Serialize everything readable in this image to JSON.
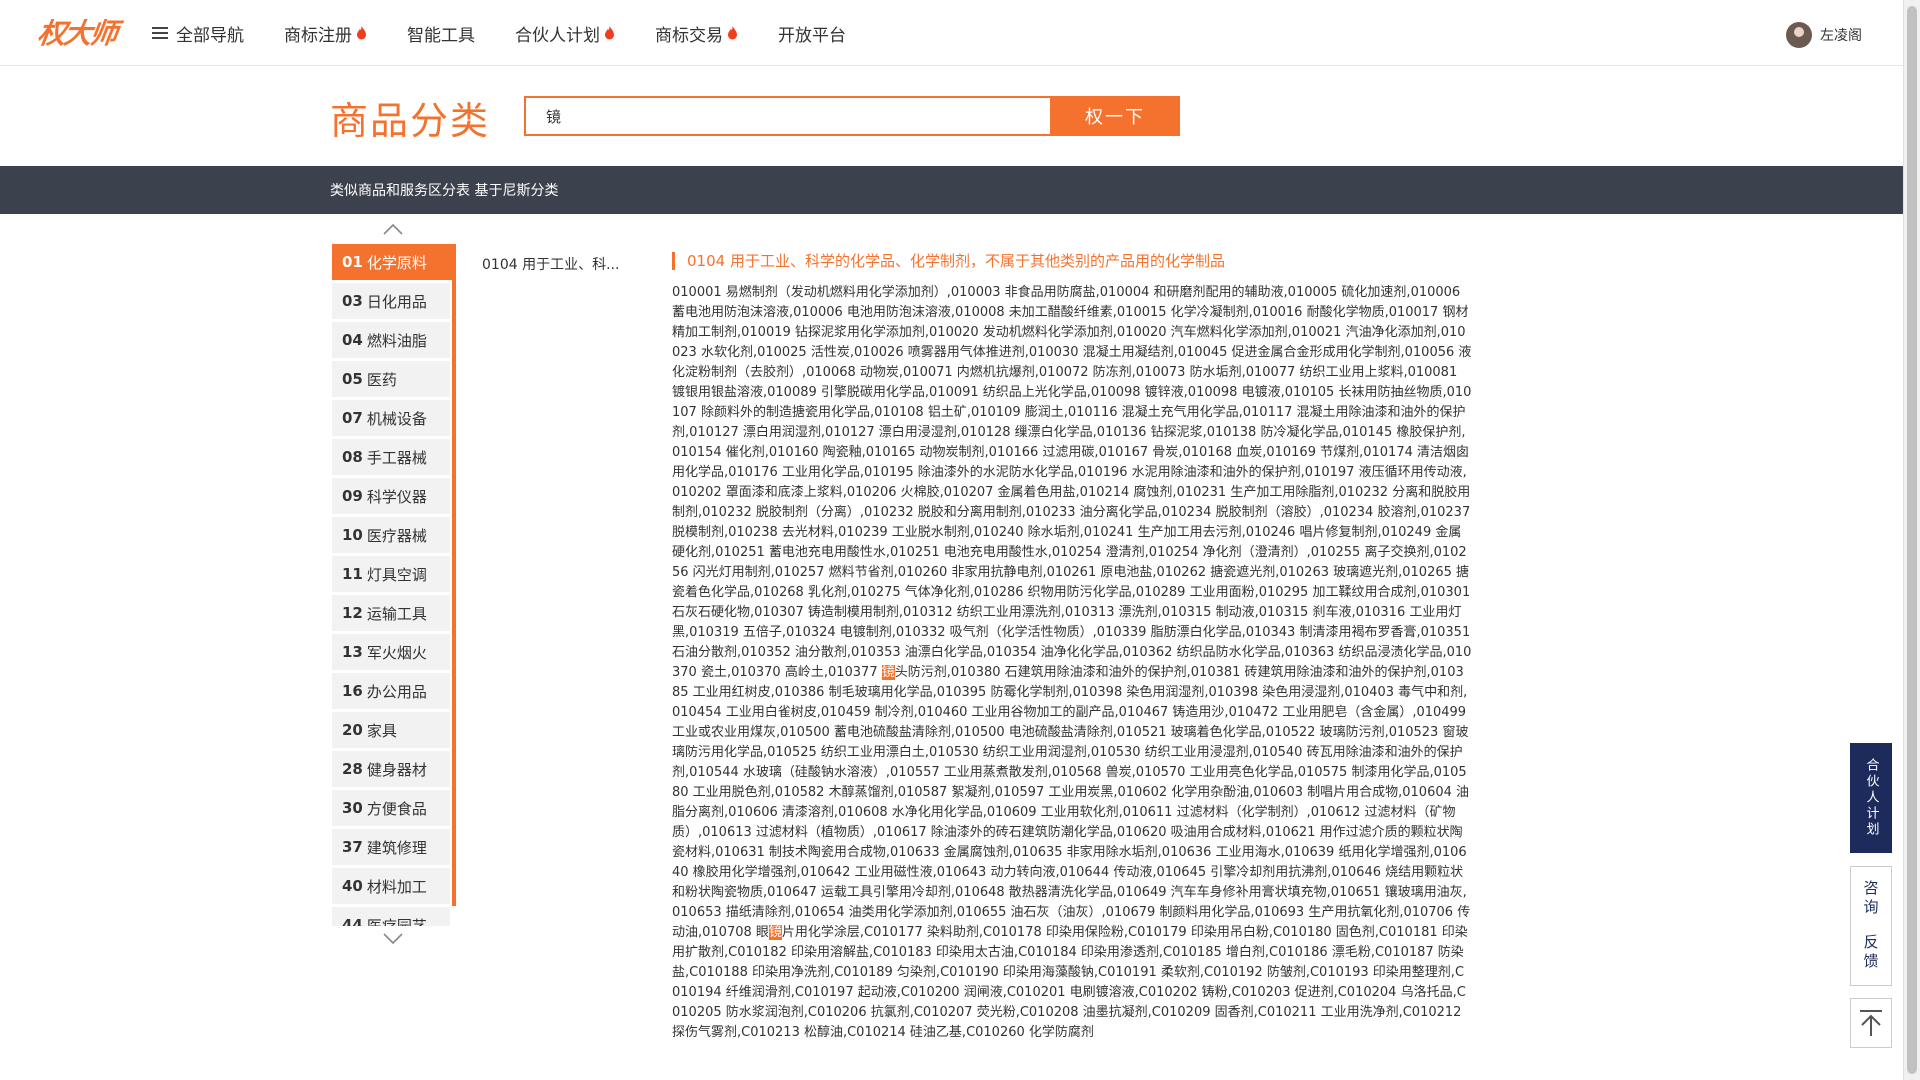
{
  "header": {
    "logo_text": "权大师",
    "nav": [
      {
        "label": "全部导航",
        "hot": false,
        "menu": true
      },
      {
        "label": "商标注册",
        "hot": true
      },
      {
        "label": "智能工具",
        "hot": false
      },
      {
        "label": "合伙人计划",
        "hot": true
      },
      {
        "label": "商标交易",
        "hot": true
      },
      {
        "label": "开放平台",
        "hot": false
      }
    ],
    "user_name": "左凌阁"
  },
  "search": {
    "title": "商品分类",
    "query": "镜",
    "button_label": "权一下"
  },
  "band": {
    "text": "类似商品和服务区分表 基于尼斯分类"
  },
  "categories": [
    {
      "num": "01",
      "label": "化学原料",
      "active": true
    },
    {
      "num": "03",
      "label": "日化用品"
    },
    {
      "num": "04",
      "label": "燃料油脂"
    },
    {
      "num": "05",
      "label": "医药"
    },
    {
      "num": "07",
      "label": "机械设备"
    },
    {
      "num": "08",
      "label": "手工器械"
    },
    {
      "num": "09",
      "label": "科学仪器"
    },
    {
      "num": "10",
      "label": "医疗器械"
    },
    {
      "num": "11",
      "label": "灯具空调"
    },
    {
      "num": "12",
      "label": "运输工具"
    },
    {
      "num": "13",
      "label": "军火烟火"
    },
    {
      "num": "16",
      "label": "办公用品"
    },
    {
      "num": "20",
      "label": "家具"
    },
    {
      "num": "28",
      "label": "健身器材"
    },
    {
      "num": "30",
      "label": "方便食品"
    },
    {
      "num": "37",
      "label": "建筑修理"
    },
    {
      "num": "40",
      "label": "材料加工"
    },
    {
      "num": "44",
      "label": "医疗园艺"
    }
  ],
  "subgroup": {
    "label": "0104 用于工业、科..."
  },
  "group": {
    "title": "0104 用于工业、科学的化学品、化学制剂，不属于其他类别的产品用的化学制品",
    "goods_before": "010001 易燃制剂（发动机燃料用化学添加剂）,010003 非食品用防腐盐,010004 和研磨剂配用的辅助液,010005 硫化加速剂,010006 蓄电池用防泡沫溶液,010006 电池用防泡沫溶液,010008 未加工醋酸纤维素,010015 化学冷凝制剂,010016 耐酸化学物质,010017 钢材精加工制剂,010019 钻探泥浆用化学添加剂,010020 发动机燃料化学添加剂,010020 汽车燃料化学添加剂,010021 汽油净化添加剂,010023 水软化剂,010025 活性炭,010026 喷雾器用气体推进剂,010030 混凝土用凝结剂,010045 促进金属合金形成用化学制剂,010056 液化淀粉制剂（去胶剂）,010068 动物炭,010071 内燃机抗爆剂,010072 防冻剂,010073 防水垢剂,010077 纺织工业用上浆料,010081 镀银用银盐溶液,010089 引擎脱碳用化学品,010091 纺织品上光化学品,010098 镀锌液,010098 电镀液,010105 长袜用防抽丝物质,010107 除颜料外的制造搪瓷用化学品,010108 铝土矿,010109 膨润土,010116 混凝土充气用化学品,010117 混凝土用除油漆和油外的保护剂,010127 漂白用润湿剂,010127 漂白用浸湿剂,010128 缫漂白化学品,010136 钻探泥浆,010138 防冷凝化学品,010145 橡胶保护剂,010154 催化剂,010160 陶瓷釉,010165 动物炭制剂,010166 过滤用碳,010167 骨炭,010168 血炭,010169 节煤剂,010174 清洁烟囱用化学品,010176 工业用化学品,010195 除油漆外的水泥防水化学品,010196 水泥用除油漆和油外的保护剂,010197 液压循环用传动液,010202 罩面漆和底漆上浆料,010206 火棉胶,010207 金属着色用盐,010214 腐蚀剂,010231 生产加工用除脂剂,010232 分离和脱胶用制剂,010232 脱胶制剂（分离）,010232 脱胶和分离用制剂,010233 油分离化学品,010234 脱胶制剂（溶胶）,010234 胶溶剂,010237 脱模制剂,010238 去光材料,010239 工业脱水制剂,010240 除水垢剂,010241 生产加工用去污剂,010246 唱片修复制剂,010249 金属硬化剂,010251 蓄电池充电用酸性水,010251 电池充电用酸性水,010254 澄清剂,010254 净化剂（澄清剂）,010255 离子交换剂,010256 闪光灯用制剂,010257 燃料节省剂,010260 非家用抗静电剂,010261 原电池盐,010262 搪瓷遮光剂,010263 玻璃遮光剂,010265 搪瓷着色化学品,010268 乳化剂,010275 气体净化剂,010286 织物用防污化学品,010289 工业用面粉,010295 加工鞣纹用合成剂,010301 石灰石硬化物,010307 铸造制模用制剂,010312 纺织工业用漂洗剂,010313 漂洗剂,010315 制动液,010315 刹车液,010316 工业用灯黑,010319 五倍子,010324 电镀制剂,010332 吸气剂（化学活性物质）,010339 脂肪漂白化学品,010343 制清漆用褐布罗香膏,010351 石油分散剂,010352 油分散剂,010353 油漂白化学品,010354 油净化化学品,010362 纺织品防水化学品,010363 纺织品浸渍化学品,010370 瓷土,010370 高岭土,010377 ",
    "hl1": "镜",
    "goods_mid": "头防污剂,010380 石建筑用除油漆和油外的保护剂,010381 砖建筑用除油漆和油外的保护剂,010385 工业用红树皮,010386 制毛玻璃用化学品,010395 防霉化学制剂,010398 染色用润湿剂,010398 染色用浸湿剂,010403 毒气中和剂,010454 工业用白雀树皮,010459 制冷剂,010460 工业用谷物加工的副产品,010467 铸造用沙,010472 工业用肥皂（含金属）,010499 工业或农业用煤灰,010500 蓄电池硫酸盐清除剂,010500 电池硫酸盐清除剂,010521 玻璃着色化学品,010522 玻璃防污剂,010523 窗玻璃防污用化学品,010525 纺织工业用漂白土,010530 纺织工业用润湿剂,010530 纺织工业用浸湿剂,010540 砖瓦用除油漆和油外的保护剂,010544 水玻璃（硅酸钠水溶液）,010557 工业用蒸煮散发剂,010568 兽炭,010570 工业用亮色化学品,010575 制漆用化学品,010580 工业用脱色剂,010582 木醇蒸馏剂,010587 絮凝剂,010597 工业用炭黑,010602 化学用杂酚油,010603 制唱片用合成物,010604 油脂分离剂,010606 清漆溶剂,010608 水净化用化学品,010609 工业用软化剂,010611 过滤材料（化学制剂）,010612 过滤材料（矿物质）,010613 过滤材料（植物质）,010617 除油漆外的砖石建筑防潮化学品,010620 吸油用合成材料,010621 用作过滤介质的颗粒状陶瓷材料,010631 制技术陶瓷用合成物,010633 金属腐蚀剂,010635 非家用除水垢剂,010636 工业用海水,010639 纸用化学增强剂,010640 橡胶用化学增强剂,010642 工业用磁性液,010643 动力转向液,010644 传动液,010645 引擎冷却剂用抗沸剂,010646 烧结用颗粒状和粉状陶瓷物质,010647 运载工具引擎用冷却剂,010648 散热器清洗化学品,010649 汽车车身修补用膏状填充物,010651 镶玻璃用油灰,010653 描纸清除剂,010654 油类用化学添加剂,010655 油石灰（油灰）,010679 制颜料用化学品,010693 生产用抗氧化剂,010706 传动油,010708 眼",
    "hl2": "镜",
    "goods_after": "片用化学涂层,C010177 染料助剂,C010178 印染用保险粉,C010179 印染用吊白粉,C010180 固色剂,C010181 印染用扩散剂,C010182 印染用溶解盐,C010183 印染用太古油,C010184 印染用渗透剂,C010185 增白剂,C010186 漂毛粉,C010187 防染盐,C010188 印染用净洗剂,C010189 匀染剂,C010190 印染用海藻酸钠,C010191 柔软剂,C010192 防皱剂,C010193 印染用整理剂,C010194 纤维润滑剂,C010197 起动液,C010200 润闸液,C010201 电刷镀溶液,C010202 铸粉,C010203 促进剂,C010204 乌洛托品,C010205 防水浆润泡剂,C010206 抗氯剂,C010207 荧光粉,C010208 油墨抗凝剂,C010209 固香剂,C010211 工业用洗净剂,C010212 探伤气雾剂,C010213 松醇油,C010214 硅油乙基,C010260 化学防腐剂"
  },
  "float": {
    "partner": "合伙人计划",
    "help_1": "咨询",
    "help_2": "反馈"
  },
  "colors": {
    "accent": "#f5722e",
    "band": "#3b424d",
    "navy": "#1d2b5c"
  }
}
